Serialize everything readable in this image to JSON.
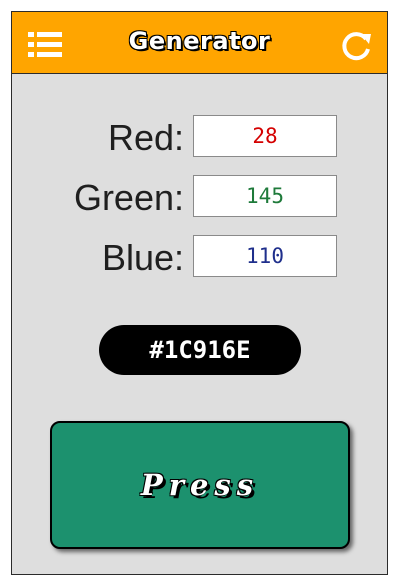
{
  "header": {
    "title": "Generator",
    "menu_icon": "hamburger-menu-icon",
    "refresh_icon": "refresh-icon",
    "background_color": "#ffa500"
  },
  "form": {
    "red": {
      "label": "Red:",
      "value": "28",
      "value_color": "#d40000"
    },
    "green": {
      "label": "Green:",
      "value": "145",
      "value_color": "#1e7a3a"
    },
    "blue": {
      "label": "Blue:",
      "value": "110",
      "value_color": "#1f2f8c"
    }
  },
  "result": {
    "hex_code": "#1C916E"
  },
  "action": {
    "press_label": "Press",
    "button_color": "#1c916e"
  }
}
